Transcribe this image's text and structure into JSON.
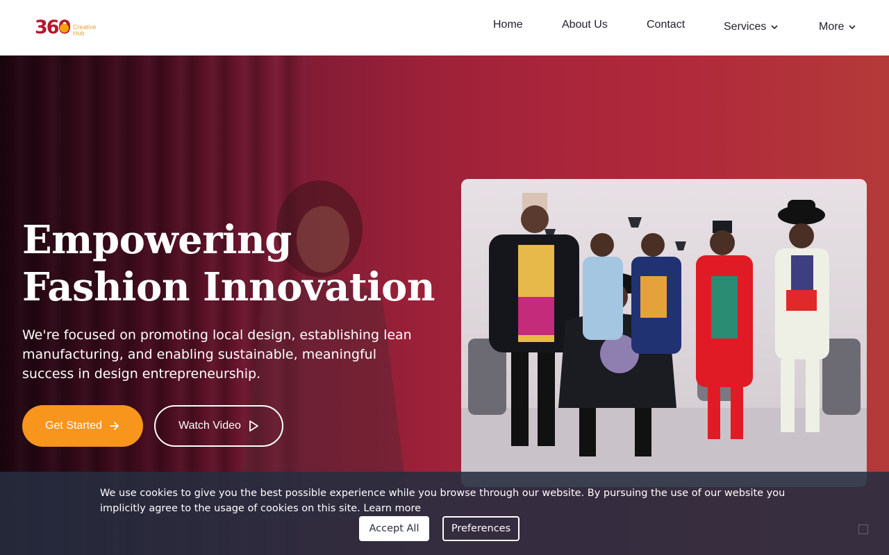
{
  "header": {
    "logo": {
      "number": "360",
      "line1": "Creative",
      "line2": "Hub"
    },
    "nav": [
      {
        "label": "Home"
      },
      {
        "label": "About Us"
      },
      {
        "label": "Contact"
      },
      {
        "label": "Services",
        "icon": "chevron-down-icon"
      },
      {
        "label": "More",
        "icon": "chevron-down-icon"
      }
    ]
  },
  "hero": {
    "title_line1": "Empowering",
    "title_line2": "Fashion Innovation",
    "description": "We're focused on promoting local design, establishing lean manufacturing, and enabling sustainable, meaningful success in design entrepreneurship.",
    "primary_button": "Get Started",
    "primary_icon": "arrow-right-icon",
    "secondary_button": "Watch Video",
    "secondary_icon": "play-icon"
  },
  "cookie": {
    "message": "We use cookies to give you the best possible experience while you browse through our website. By pursuing the use of our website you implicitly agree to the usage of cookies on this site.",
    "learn_more": "Learn more",
    "accept": "Accept All",
    "preferences": "Preferences"
  },
  "colors": {
    "brand_red": "#b5172f",
    "accent_orange": "#f8951d",
    "hero_gradient_end": "#b43a39",
    "cookie_bg": "#262d40"
  }
}
